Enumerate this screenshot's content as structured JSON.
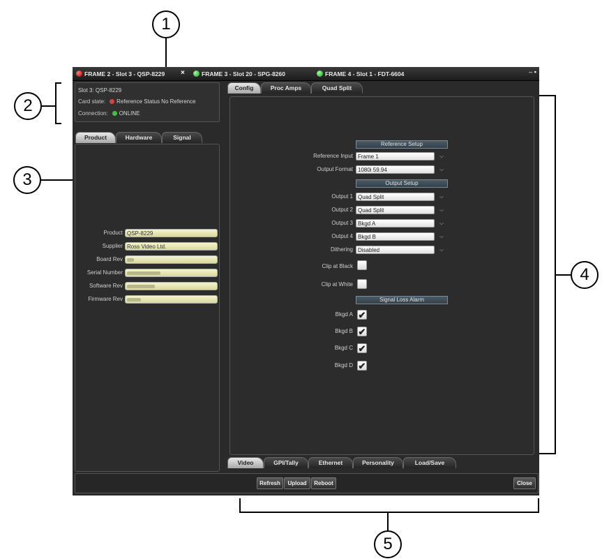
{
  "callouts": [
    "1",
    "2",
    "3",
    "4",
    "5"
  ],
  "titlebar": {
    "tabs": [
      {
        "label": "FRAME 2 - Slot 3 - QSP-8229",
        "status": "red"
      },
      {
        "label": "FRAME 3 - Slot 20 - SPG-8260",
        "status": "green"
      },
      {
        "label": "FRAME 4 - Slot 1 - FDT-6604",
        "status": "green"
      }
    ],
    "close_glyph": "×",
    "window_controls": "– ▪"
  },
  "info": {
    "slot": "Slot 3: QSP-8229",
    "card_state_label": "Card state:",
    "card_state_value": "Reference Status No Reference",
    "connection_label": "Connection:",
    "connection_value": "ONLINE"
  },
  "left_tabs": [
    "Product",
    "Hardware",
    "Signal"
  ],
  "product": {
    "fields": [
      {
        "label": "Product",
        "value": "QSP-8229"
      },
      {
        "label": "Supplier",
        "value": "Ross Video Ltd."
      },
      {
        "label": "Board Rev",
        "value": ""
      },
      {
        "label": "Serial Number",
        "value": ""
      },
      {
        "label": "Software Rev",
        "value": ""
      },
      {
        "label": "Firmware Rev",
        "value": ""
      }
    ]
  },
  "top_tabs": [
    "Config",
    "Proc Amps",
    "Quad Split"
  ],
  "config": {
    "reference_setup": "Reference Setup",
    "reference_input_label": "Reference Input",
    "reference_input_value": "Frame 1",
    "output_format_label": "Output Format",
    "output_format_value": "1080i 59.94",
    "output_setup": "Output Setup",
    "outputs": [
      {
        "label": "Output 1",
        "value": "Quad Split"
      },
      {
        "label": "Output 2",
        "value": "Quad Split"
      },
      {
        "label": "Output 3",
        "value": "Bkgd A"
      },
      {
        "label": "Output 4",
        "value": "Bkgd B"
      }
    ],
    "dithering_label": "Dithering",
    "dithering_value": "Disabled",
    "clip_black_label": "Clip at Black",
    "clip_black_checked": false,
    "clip_white_label": "Clip at White",
    "clip_white_checked": false,
    "signal_loss_alarm": "Signal Loss Alarm",
    "alarms": [
      {
        "label": "Bkgd A",
        "checked": true
      },
      {
        "label": "Bkgd B",
        "checked": true
      },
      {
        "label": "Bkgd C",
        "checked": true
      },
      {
        "label": "Bkgd D",
        "checked": true
      }
    ],
    "check_glyph": "✔",
    "arrow_glyph": "⌵"
  },
  "bottom_tabs": [
    "Video",
    "GPI/Tally",
    "Ethernet",
    "Personality",
    "Load/Save"
  ],
  "bottom_bar": {
    "refresh": "Refresh",
    "upload": "Upload",
    "reboot": "Reboot",
    "close": "Close"
  }
}
